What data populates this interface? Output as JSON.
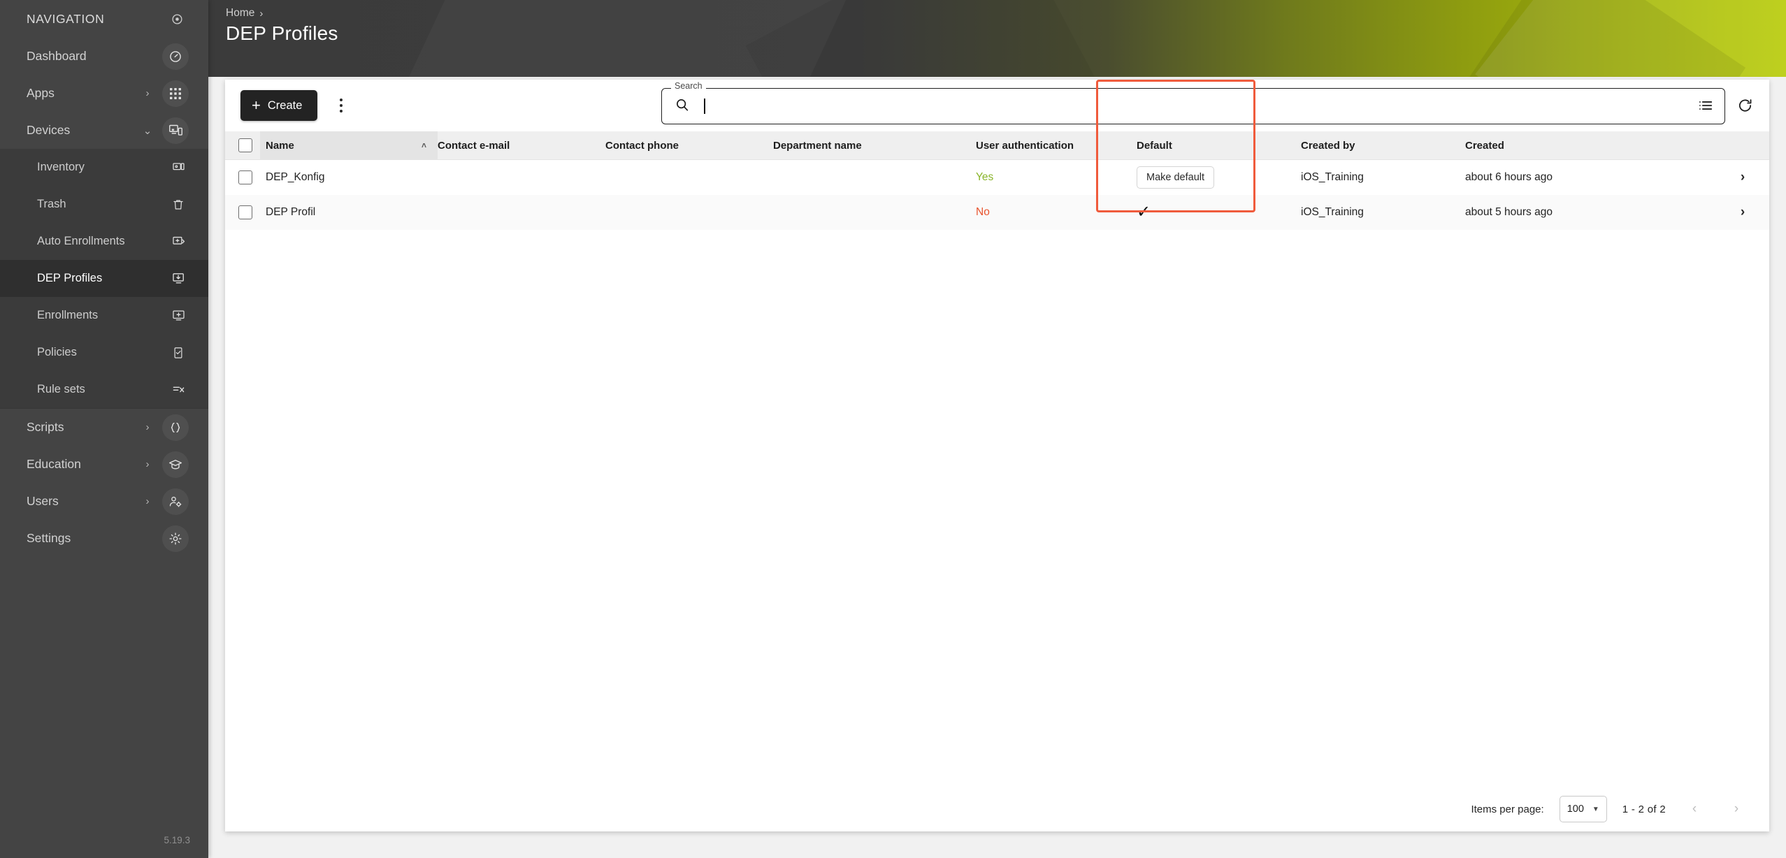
{
  "sidebar": {
    "title": "NAVIGATION",
    "title_icon": "target-icon",
    "version": "5.19.3",
    "items": [
      {
        "label": "Dashboard",
        "icon": "dashboard-icon",
        "expandable": false
      },
      {
        "label": "Apps",
        "icon": "apps-grid-icon",
        "expandable": true,
        "expanded": false
      },
      {
        "label": "Devices",
        "icon": "devices-icon",
        "expandable": true,
        "expanded": true
      }
    ],
    "devices_children": [
      {
        "label": "Inventory",
        "icon": "inventory-icon",
        "active": false
      },
      {
        "label": "Trash",
        "icon": "trash-icon",
        "active": false
      },
      {
        "label": "Auto Enrollments",
        "icon": "auto-enrollments-icon",
        "active": false
      },
      {
        "label": "DEP Profiles",
        "icon": "dep-profiles-icon",
        "active": true
      },
      {
        "label": "Enrollments",
        "icon": "enrollments-icon",
        "active": false
      },
      {
        "label": "Policies",
        "icon": "policies-icon",
        "active": false
      },
      {
        "label": "Rule sets",
        "icon": "rule-sets-icon",
        "active": false
      }
    ],
    "items_bottom": [
      {
        "label": "Scripts",
        "icon": "braces-icon",
        "expandable": true
      },
      {
        "label": "Education",
        "icon": "graduation-cap-icon",
        "expandable": true
      },
      {
        "label": "Users",
        "icon": "user-settings-icon",
        "expandable": true
      },
      {
        "label": "Settings",
        "icon": "gear-icon",
        "expandable": false
      }
    ]
  },
  "header": {
    "breadcrumb_home": "Home",
    "breadcrumb_separator": "›",
    "title": "DEP Profiles",
    "accent_color": "#b7cb06"
  },
  "toolbar": {
    "create_label": "Create",
    "create_icon": "plus-icon",
    "overflow_icon": "kebab-menu-icon",
    "columns_icon": "list-columns-icon",
    "refresh_icon": "refresh-icon"
  },
  "search": {
    "label": "Search",
    "value": "",
    "placeholder": "",
    "icon": "search-icon"
  },
  "table": {
    "select_all_checked": false,
    "sort_column": "Name",
    "sort_direction": "asc",
    "sort_caret": "˄",
    "columns": [
      "Name",
      "Contact e-mail",
      "Contact phone",
      "Department name",
      "User authentication",
      "Default",
      "Created by",
      "Created"
    ],
    "rows": [
      {
        "checked": false,
        "name": "DEP_Konfig",
        "contact_email": "",
        "contact_phone": "",
        "department_name": "",
        "user_authentication": "Yes",
        "default_kind": "button",
        "default_label": "Make default",
        "created_by": "iOS_Training",
        "created": "about 6 hours ago",
        "row_arrow": "›"
      },
      {
        "checked": false,
        "name": "DEP Profil",
        "contact_email": "",
        "contact_phone": "",
        "department_name": "",
        "user_authentication": "No",
        "default_kind": "check",
        "default_label": "✓",
        "created_by": "iOS_Training",
        "created": "about 5 hours ago",
        "row_arrow": "›"
      }
    ],
    "highlight": {
      "column": "Default",
      "color": "#f05b3c"
    }
  },
  "paginator": {
    "items_per_page_label": "Items per page:",
    "items_per_page_value": "100",
    "dropdown_icon": "chevron-down-icon",
    "range_label": "1 - 2 of 2",
    "prev_icon": "‹",
    "next_icon": "›"
  }
}
